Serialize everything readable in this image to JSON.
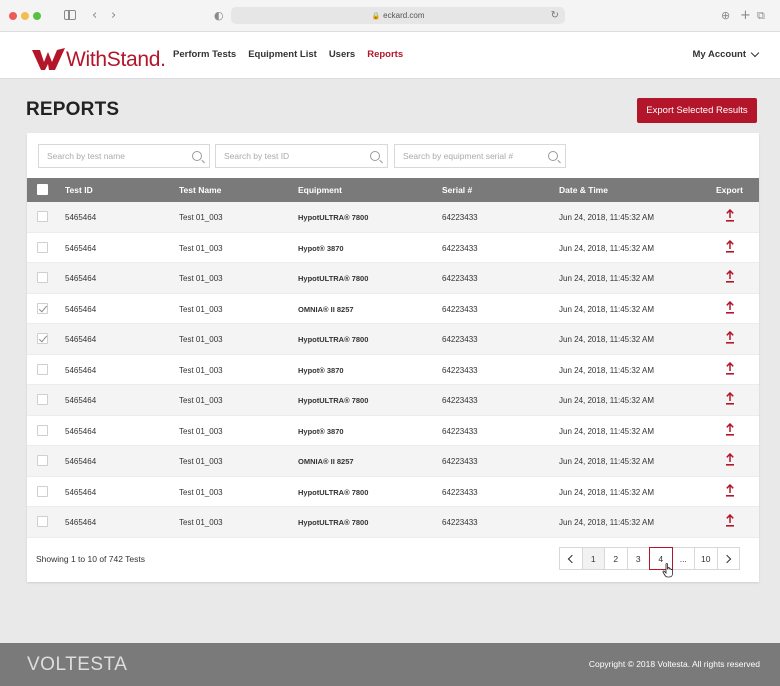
{
  "browser": {
    "url": "eckard.com"
  },
  "header": {
    "logo_text": "WithStand.",
    "nav": [
      "Perform Tests",
      "Equipment List",
      "Users",
      "Reports"
    ],
    "active_nav": "Reports",
    "account_label": "My Account"
  },
  "page": {
    "title": "REPORTS",
    "export_button": "Export Selected Results"
  },
  "search": {
    "test_name_placeholder": "Search by test name",
    "test_id_placeholder": "Search by test ID",
    "serial_placeholder": "Search by equipment serial #"
  },
  "table": {
    "columns": [
      "Test ID",
      "Test Name",
      "Equipment",
      "Serial #",
      "Date & Time",
      "Export"
    ],
    "rows": [
      {
        "id": "5465464",
        "name": "Test 01_003",
        "equipment": "HypotULTRA® 7800",
        "serial": "64223433",
        "datetime": "Jun 24, 2018, 11:45:32 AM",
        "checked": false
      },
      {
        "id": "5465464",
        "name": "Test 01_003",
        "equipment": "Hypot® 3870",
        "serial": "64223433",
        "datetime": "Jun 24, 2018, 11:45:32 AM",
        "checked": false
      },
      {
        "id": "5465464",
        "name": "Test 01_003",
        "equipment": "HypotULTRA® 7800",
        "serial": "64223433",
        "datetime": "Jun 24, 2018, 11:45:32 AM",
        "checked": false
      },
      {
        "id": "5465464",
        "name": "Test 01_003",
        "equipment": "OMNIA® II 8257",
        "serial": "64223433",
        "datetime": "Jun 24, 2018, 11:45:32 AM",
        "checked": true
      },
      {
        "id": "5465464",
        "name": "Test 01_003",
        "equipment": "HypotULTRA® 7800",
        "serial": "64223433",
        "datetime": "Jun 24, 2018, 11:45:32 AM",
        "checked": true
      },
      {
        "id": "5465464",
        "name": "Test 01_003",
        "equipment": "Hypot® 3870",
        "serial": "64223433",
        "datetime": "Jun 24, 2018, 11:45:32 AM",
        "checked": false
      },
      {
        "id": "5465464",
        "name": "Test 01_003",
        "equipment": "HypotULTRA® 7800",
        "serial": "64223433",
        "datetime": "Jun 24, 2018, 11:45:32 AM",
        "checked": false
      },
      {
        "id": "5465464",
        "name": "Test 01_003",
        "equipment": "Hypot® 3870",
        "serial": "64223433",
        "datetime": "Jun 24, 2018, 11:45:32 AM",
        "checked": false
      },
      {
        "id": "5465464",
        "name": "Test 01_003",
        "equipment": "OMNIA® II 8257",
        "serial": "64223433",
        "datetime": "Jun 24, 2018, 11:45:32 AM",
        "checked": false
      },
      {
        "id": "5465464",
        "name": "Test 01_003",
        "equipment": "HypotULTRA® 7800",
        "serial": "64223433",
        "datetime": "Jun 24, 2018, 11:45:32 AM",
        "checked": false
      },
      {
        "id": "5465464",
        "name": "Test 01_003",
        "equipment": "HypotULTRA® 7800",
        "serial": "64223433",
        "datetime": "Jun 24, 2018, 11:45:32 AM",
        "checked": false
      }
    ]
  },
  "pagination": {
    "summary": "Showing 1 to 10 of 742 Tests",
    "pages": [
      "1",
      "2",
      "3",
      "4",
      "...",
      "10"
    ],
    "current_page": "1",
    "hovered_page": "4"
  },
  "footer": {
    "brand": "VOLTESTA",
    "copyright": "Copyright © 2018 Voltesta. All rights reserved"
  },
  "colors": {
    "brand": "#b3162a",
    "table_header": "#7a7a7a",
    "footer": "#7a7a7a"
  },
  "icons": [
    "search-icon",
    "upload-icon",
    "chevron-down-icon",
    "chevron-left-icon",
    "chevron-right-icon",
    "lock-icon",
    "reload-icon",
    "cursor-hand-icon"
  ]
}
